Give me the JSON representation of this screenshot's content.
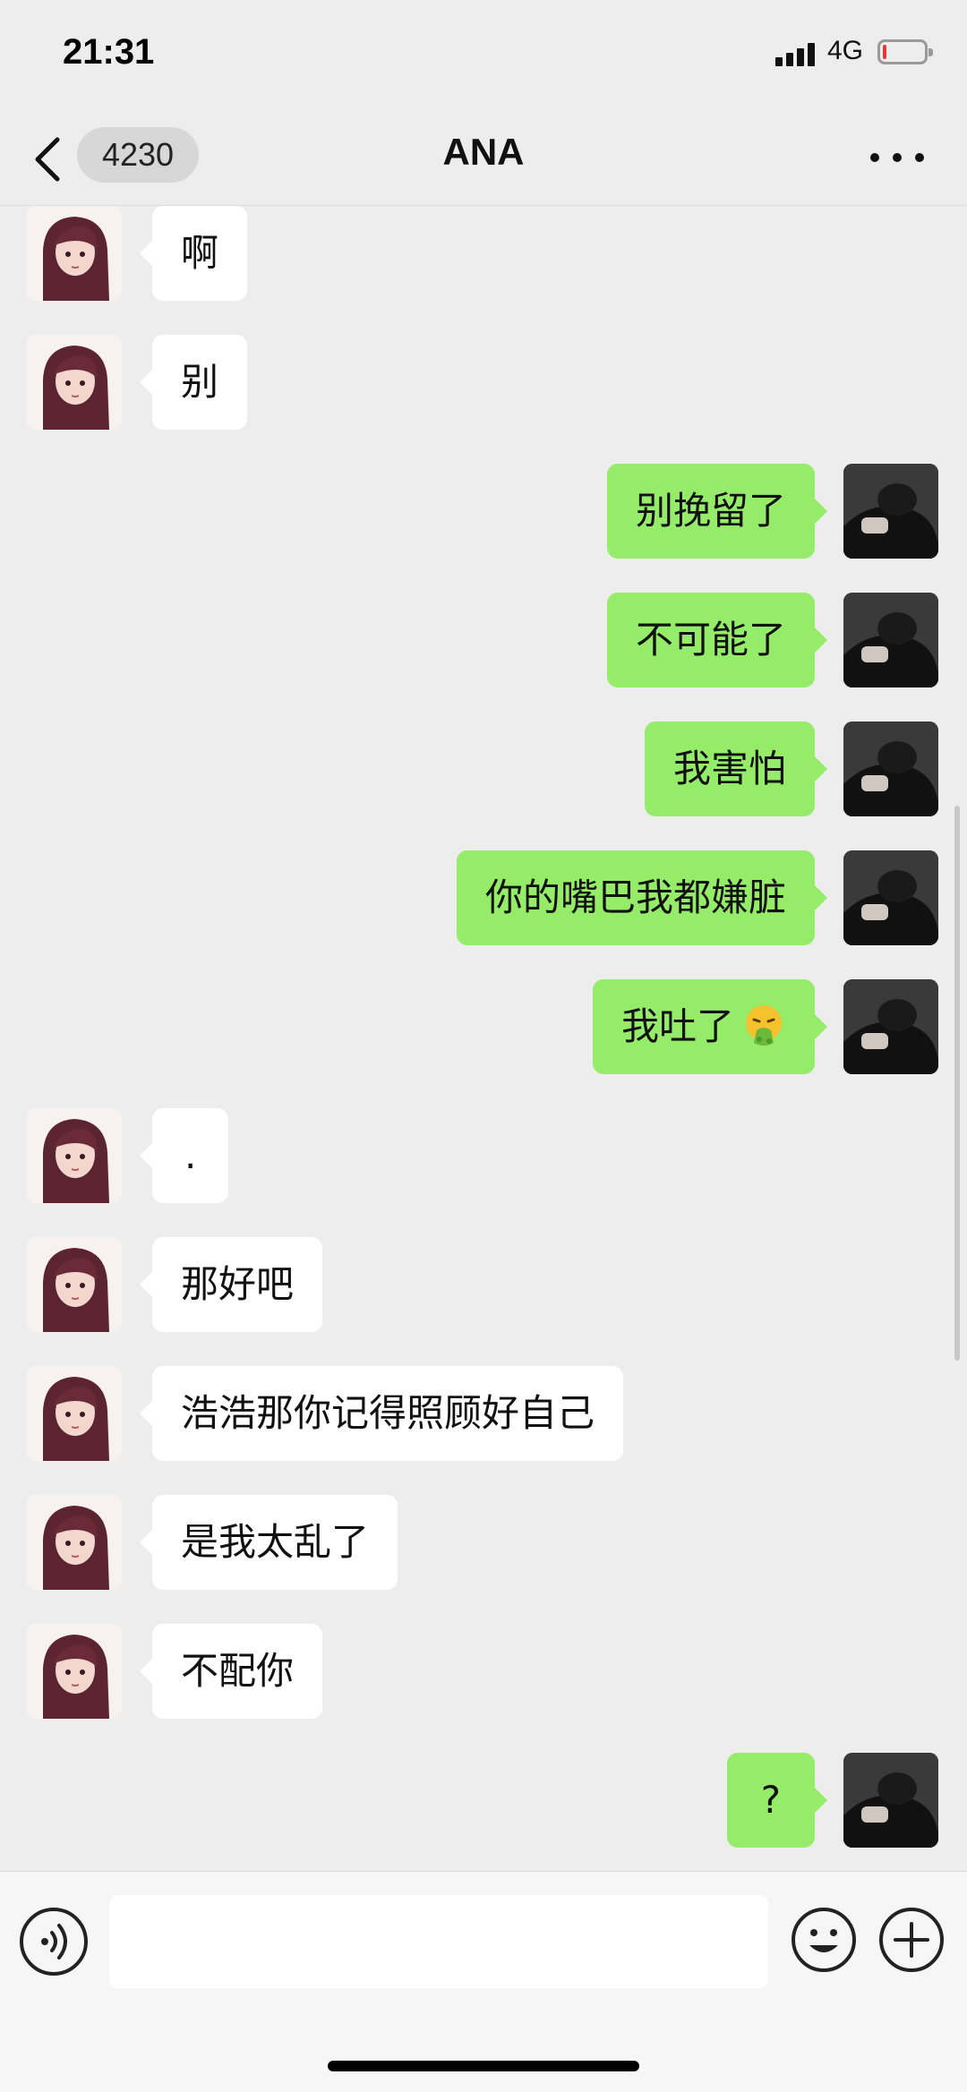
{
  "status_bar": {
    "time": "21:31",
    "network": "4G",
    "battery_level": 0.08
  },
  "header": {
    "back_icon": "chevron-left-icon",
    "unread_count": "4230",
    "title": "ANA",
    "more_icon": "more-dots-icon"
  },
  "messages": [
    {
      "side": "in",
      "text": "啊"
    },
    {
      "side": "in",
      "text": "别"
    },
    {
      "side": "out",
      "text": "别挽留了"
    },
    {
      "side": "out",
      "text": "不可能了"
    },
    {
      "side": "out",
      "text": "我害怕"
    },
    {
      "side": "out",
      "text": "你的嘴巴我都嫌脏"
    },
    {
      "side": "out",
      "text": "我吐了",
      "emoji": "vomit-emoji-icon"
    },
    {
      "side": "in",
      "text": "."
    },
    {
      "side": "in",
      "text": "那好吧"
    },
    {
      "side": "in",
      "text": "浩浩那你记得照顾好自己"
    },
    {
      "side": "in",
      "text": "是我太乱了"
    },
    {
      "side": "in",
      "text": "不配你"
    },
    {
      "side": "out",
      "text": "?"
    }
  ],
  "input_bar": {
    "voice_icon": "voice-icon",
    "message_value": "",
    "emoji_icon": "emoji-icon",
    "plus_icon": "plus-icon"
  },
  "colors": {
    "background": "#ededed",
    "outgoing_bubble": "#95ec69",
    "incoming_bubble": "#ffffff"
  }
}
